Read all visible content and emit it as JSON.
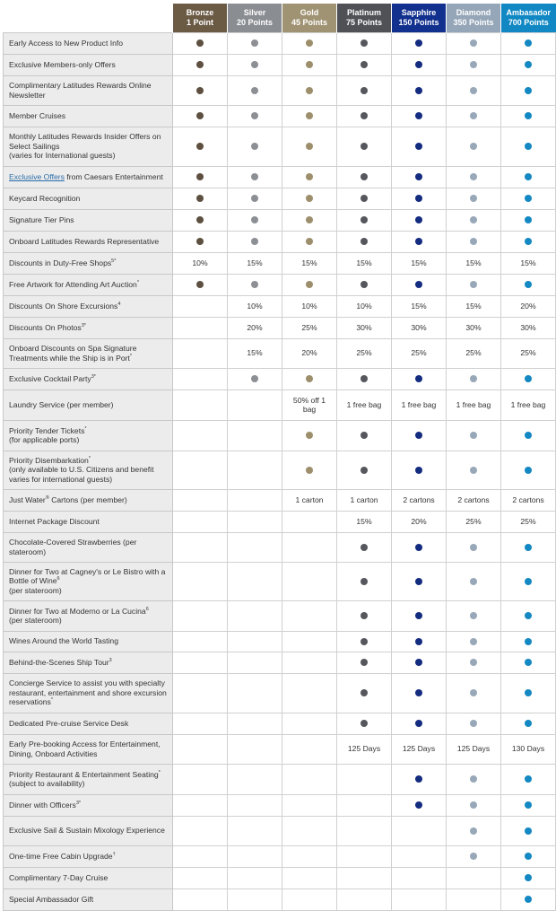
{
  "tiers": [
    {
      "name": "Bronze",
      "points": "1 Point",
      "color": "#6b5b45",
      "dot": "#5e5040"
    },
    {
      "name": "Silver",
      "points": "20 Points",
      "color": "#8a8d92",
      "dot": "#8c8f94"
    },
    {
      "name": "Gold",
      "points": "45 Points",
      "color": "#a09373",
      "dot": "#9d8f6c"
    },
    {
      "name": "Platinum",
      "points": "75 Points",
      "color": "#4f5156",
      "dot": "#55575c"
    },
    {
      "name": "Sapphire",
      "points": "150 Points",
      "color": "#12308e",
      "dot": "#142c80"
    },
    {
      "name": "Diamond",
      "points": "350 Points",
      "color": "#95a6b8",
      "dot": "#98a8b8"
    },
    {
      "name": "Ambasador",
      "points": "700 Points",
      "color": "#1188c4",
      "dot": "#1488c2"
    }
  ],
  "rows": [
    {
      "label": "Early Access to New Product Info",
      "sup": "",
      "h": 0,
      "cells": [
        "dot",
        "dot",
        "dot",
        "dot",
        "dot",
        "dot",
        "dot"
      ]
    },
    {
      "label": "Exclusive Members-only Offers",
      "sup": "",
      "cells": [
        "dot",
        "dot",
        "dot",
        "dot",
        "dot",
        "dot",
        "dot"
      ]
    },
    {
      "label": "Complimentary Latitudes Rewards Online Newsletter",
      "sup": "",
      "cells": [
        "dot",
        "dot",
        "dot",
        "dot",
        "dot",
        "dot",
        "dot"
      ]
    },
    {
      "label": "Member Cruises",
      "sup": "",
      "cells": [
        "dot",
        "dot",
        "dot",
        "dot",
        "dot",
        "dot",
        "dot"
      ]
    },
    {
      "label": "Monthly Latitudes Rewards Insider Offers on Select Sailings",
      "sub": "(varies for International guests)",
      "sup": "",
      "cells": [
        "dot",
        "dot",
        "dot",
        "dot",
        "dot",
        "dot",
        "dot"
      ]
    },
    {
      "link": "Exclusive Offers",
      "label": " from Caesars Entertainment",
      "sup": "",
      "cells": [
        "dot",
        "dot",
        "dot",
        "dot",
        "dot",
        "dot",
        "dot"
      ]
    },
    {
      "label": "Keycard Recognition",
      "sup": "",
      "cells": [
        "dot",
        "dot",
        "dot",
        "dot",
        "dot",
        "dot",
        "dot"
      ]
    },
    {
      "label": "Signature Tier Pins",
      "sup": "",
      "cells": [
        "dot",
        "dot",
        "dot",
        "dot",
        "dot",
        "dot",
        "dot"
      ]
    },
    {
      "label": "Onboard Latitudes Rewards Representative",
      "sup": "",
      "cells": [
        "dot",
        "dot",
        "dot",
        "dot",
        "dot",
        "dot",
        "dot"
      ]
    },
    {
      "label": "Discounts in Duty-Free Shops",
      "sup": "5*",
      "cells": [
        "10%",
        "15%",
        "15%",
        "15%",
        "15%",
        "15%",
        "15%"
      ]
    },
    {
      "label": "Free Artwork for Attending Art Auction",
      "sup": "*",
      "cells": [
        "dot",
        "dot",
        "dot",
        "dot",
        "dot",
        "dot",
        "dot"
      ]
    },
    {
      "label": "Discounts On Shore Excursions",
      "sup": "4",
      "cells": [
        "",
        "10%",
        "10%",
        "10%",
        "15%",
        "15%",
        "20%"
      ]
    },
    {
      "label": "Discounts On Photos",
      "sup": "3*",
      "cells": [
        "",
        "20%",
        "25%",
        "30%",
        "30%",
        "30%",
        "30%"
      ]
    },
    {
      "label": "Onboard Discounts on Spa Signature Treatments while the Ship is in Port",
      "sup": "*",
      "cells": [
        "",
        "15%",
        "20%",
        "25%",
        "25%",
        "25%",
        "25%"
      ]
    },
    {
      "label": "Exclusive Cocktail Party",
      "sup": "3*",
      "cells": [
        "",
        "dot",
        "dot",
        "dot",
        "dot",
        "dot",
        "dot"
      ]
    },
    {
      "label": "Laundry Service (per member)",
      "sup": "",
      "cells": [
        "",
        "",
        "50% off 1 bag",
        "1 free bag",
        "1 free bag",
        "1 free bag",
        "1 free bag"
      ]
    },
    {
      "label": "Priority Tender Tickets",
      "sup": "*",
      "sub": "(for applicable ports)",
      "cells": [
        "",
        "",
        "dot",
        "dot",
        "dot",
        "dot",
        "dot"
      ]
    },
    {
      "label": "Priority Disembarkation",
      "sup": "*",
      "sub": "(only available to U.S. Citizens and benefit varies for international guests)",
      "cells": [
        "",
        "",
        "dot",
        "dot",
        "dot",
        "dot",
        "dot"
      ]
    },
    {
      "label": "Just Water",
      "sup": "®",
      "label2": " Cartons (per member)",
      "cells": [
        "",
        "",
        "1 carton",
        "1 carton",
        "2 cartons",
        "2 cartons",
        "2 cartons"
      ]
    },
    {
      "label": "Internet Package Discount",
      "sup": "",
      "cells": [
        "",
        "",
        "",
        "15%",
        "20%",
        "25%",
        "25%"
      ]
    },
    {
      "label": "Chocolate-Covered Strawberries (per stateroom)",
      "sup": "",
      "cells": [
        "",
        "",
        "",
        "dot",
        "dot",
        "dot",
        "dot"
      ]
    },
    {
      "label": "Dinner for Two at Cagney's or Le Bistro with a Bottle of Wine",
      "sup": "6",
      "sub": "(per stateroom)",
      "cells": [
        "",
        "",
        "",
        "dot",
        "dot",
        "dot",
        "dot"
      ]
    },
    {
      "label": "Dinner for Two at Moderno or La Cucina",
      "sup": "6",
      "sub": "(per stateroom)",
      "cells": [
        "",
        "",
        "",
        "dot",
        "dot",
        "dot",
        "dot"
      ]
    },
    {
      "label": "Wines Around the World Tasting",
      "sup": "",
      "cells": [
        "",
        "",
        "",
        "dot",
        "dot",
        "dot",
        "dot"
      ]
    },
    {
      "label": "Behind-the-Scenes Ship Tour",
      "sup": "3",
      "cells": [
        "",
        "",
        "",
        "dot",
        "dot",
        "dot",
        "dot"
      ]
    },
    {
      "label": "Concierge Service to assist you with specialty restaurant, entertainment and shore excursion reservations",
      "sup": "*",
      "cells": [
        "",
        "",
        "",
        "dot",
        "dot",
        "dot",
        "dot"
      ]
    },
    {
      "label": "Dedicated Pre-cruise Service Desk",
      "sup": "",
      "cells": [
        "",
        "",
        "",
        "dot",
        "dot",
        "dot",
        "dot"
      ]
    },
    {
      "label": "Early Pre-booking Access for Entertainment, Dining, Onboard Activities",
      "sup": "",
      "cells": [
        "",
        "",
        "",
        "125 Days",
        "125 Days",
        "125 Days",
        "130 Days"
      ]
    },
    {
      "label": "Priority Restaurant & Entertainment Seating",
      "sup": "*",
      "sub": "(subject to availability)",
      "cells": [
        "",
        "",
        "",
        "",
        "dot",
        "dot",
        "dot"
      ]
    },
    {
      "label": "Dinner with Officers",
      "sup": "3*",
      "cells": [
        "",
        "",
        "",
        "",
        "dot",
        "dot",
        "dot"
      ]
    },
    {
      "label": "Exclusive Sail & Sustain Mixology Experience",
      "sup": "",
      "cells": [
        "",
        "",
        "",
        "",
        "",
        "dot",
        "dot"
      ]
    },
    {
      "label": "One-time Free Cabin Upgrade",
      "sup": "†",
      "cells": [
        "",
        "",
        "",
        "",
        "",
        "dot",
        "dot"
      ]
    },
    {
      "label": "Complimentary 7-Day Cruise",
      "sup": "",
      "cells": [
        "",
        "",
        "",
        "",
        "",
        "",
        "dot"
      ]
    },
    {
      "label": "Special Ambassador Gift",
      "sup": "",
      "cells": [
        "",
        "",
        "",
        "",
        "",
        "",
        "dot"
      ]
    }
  ]
}
